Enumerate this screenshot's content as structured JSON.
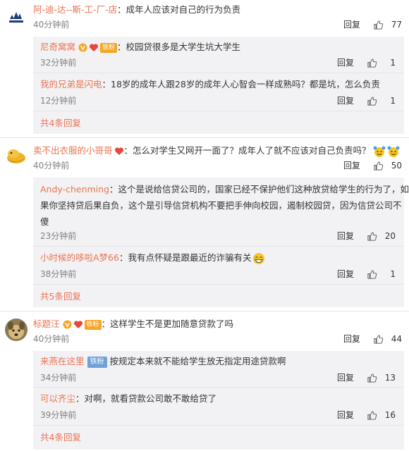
{
  "colors": {
    "username": "#eb7350",
    "text": "#333333",
    "meta": "#808080",
    "reply_bg": "#f2f2f5",
    "fan_badge": "#f5a623",
    "iron_badge": "#6fa0d8"
  },
  "threads": [
    {
      "user": "阿-迪-达--斯-工-厂-店",
      "avatar_icon": "adidas-logo-avatar",
      "text": "：成年人应该对自己的行为负责",
      "time": "40分钟前",
      "reply_label": "回复",
      "likes": "77",
      "replies": [
        {
          "user": "尼奇窝窝",
          "badges": [
            "verified-v-icon",
            "fan-badge"
          ],
          "fan_label": "铁粉",
          "text": "：校园贷很多是大学生坑大学生",
          "time": "32分钟前",
          "reply_label": "回复",
          "likes": "1"
        },
        {
          "user": "我的兄弟是闪电",
          "text": "：18岁的成年人跟28岁的成年人心智会一样成熟吗？都是坑，怎么负责",
          "time": "12分钟前",
          "reply_label": "回复",
          "likes": "1"
        }
      ],
      "more": "共4条回复"
    },
    {
      "user": "卖不出衣服的小哥哥",
      "avatar_icon": "cartoon-cat-avatar",
      "text": "：怎么对学生又网开一面了？成年人了就不应该对自己负责吗？",
      "emoji_icons": [
        "cheer-emoji-icon",
        "cheer-emoji-icon"
      ],
      "time": "40分钟前",
      "reply_label": "回复",
      "likes": "50",
      "replies": [
        {
          "user": "Andy-chenming",
          "text": "：这个是说给信贷公司的，国家已经不保护他们这种放贷给学生的行为了，如果你坚持贷后果自负，这个是引导信贷机构不要把手伸向校园，遏制校园贷，因为信贷公司不傻",
          "text_lines": [
            "：这个是说给信贷公司的，国家已经不保护他们这种放贷给学生的行为了，如",
            "果你坚持贷后果自负，这个是引导信贷机构不要把手伸向校园，遏制校园贷，因为信贷公司不",
            "傻"
          ],
          "time": "23分钟前",
          "reply_label": "回复",
          "likes": "20"
        },
        {
          "user": "小时候的哆啦A梦66",
          "text": "：我有点怀疑是跟最近的诈骗有关",
          "emoji_icons": [
            "laugh-emoji-icon"
          ],
          "time": "38分钟前",
          "reply_label": "回复",
          "likes": "1"
        }
      ],
      "more": "共5条回复"
    },
    {
      "user": "标题汪",
      "avatar_icon": "dog-avatar",
      "badges": [
        "verified-v-icon",
        "fan-badge"
      ],
      "fan_label": "铁粉",
      "text": "：这样学生不是更加随意贷款了吗",
      "time": "40分钟前",
      "reply_label": "回复",
      "likes": "44",
      "replies": [
        {
          "user": "来燕在这里",
          "iron_label": "铁粉",
          "text": "按规定本来就不能给学生放无指定用途贷款啊",
          "time": "34分钟前",
          "reply_label": "回复",
          "likes": "13"
        },
        {
          "user": "可以齐尘",
          "text": "：对啊，就看贷款公司敢不敢给贷了",
          "time": "39分钟前",
          "reply_label": "回复",
          "likes": "16"
        }
      ],
      "more": "共4条回复"
    }
  ]
}
